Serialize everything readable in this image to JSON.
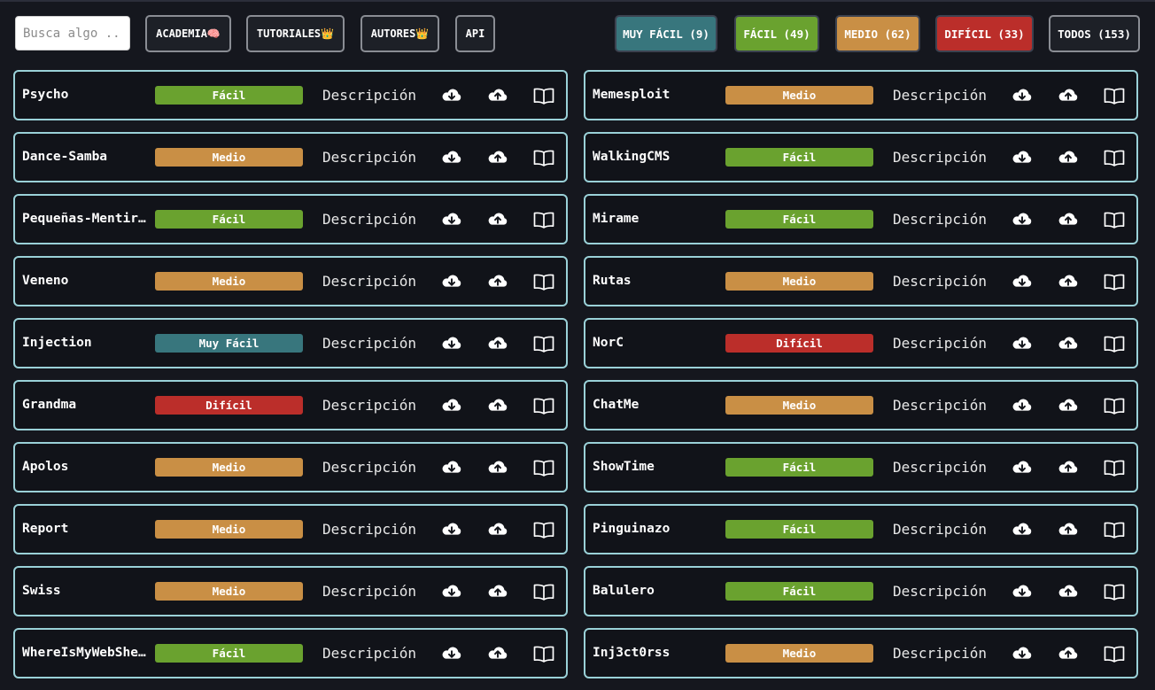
{
  "search": {
    "placeholder": "Busca algo ..."
  },
  "nav": {
    "academia": "ACADEMIA🧠",
    "tutoriales": "TUTORIALES👑",
    "autores": "AUTORES👑",
    "api": "API"
  },
  "filters": [
    {
      "label": "MUY FÁCIL (9)",
      "color": "#38767d"
    },
    {
      "label": "FÁCIL (49)",
      "color": "#6aa22f"
    },
    {
      "label": "MEDIO (62)",
      "color": "#c98f45"
    },
    {
      "label": "DIFÍCIL (33)",
      "color": "#bb2e2a"
    },
    {
      "label": "TODOS (153)",
      "color": "#1d2027"
    }
  ],
  "difficulty_colors": {
    "Muy Fácil": "#38767d",
    "Fácil": "#6aa22f",
    "Medio": "#c98f45",
    "Difícil": "#bb2e2a"
  },
  "description_label": "Descripción",
  "icons": {
    "download": "cloud-download-icon",
    "upload": "cloud-upload-icon",
    "writeup": "open-book-icon"
  },
  "machines_left": [
    {
      "name": "Psycho",
      "difficulty": "Fácil"
    },
    {
      "name": "Dance-Samba",
      "difficulty": "Medio"
    },
    {
      "name": "Pequeñas-Mentirosas",
      "difficulty": "Fácil"
    },
    {
      "name": "Veneno",
      "difficulty": "Medio"
    },
    {
      "name": "Injection",
      "difficulty": "Muy Fácil"
    },
    {
      "name": "Grandma",
      "difficulty": "Difícil"
    },
    {
      "name": "Apolos",
      "difficulty": "Medio"
    },
    {
      "name": "Report",
      "difficulty": "Medio"
    },
    {
      "name": "Swiss",
      "difficulty": "Medio"
    },
    {
      "name": "WhereIsMyWebShell",
      "difficulty": "Fácil"
    }
  ],
  "machines_right": [
    {
      "name": "Memesploit",
      "difficulty": "Medio"
    },
    {
      "name": "WalkingCMS",
      "difficulty": "Fácil"
    },
    {
      "name": "Mirame",
      "difficulty": "Fácil"
    },
    {
      "name": "Rutas",
      "difficulty": "Medio"
    },
    {
      "name": "NorC",
      "difficulty": "Difícil"
    },
    {
      "name": "ChatMe",
      "difficulty": "Medio"
    },
    {
      "name": "ShowTime",
      "difficulty": "Fácil"
    },
    {
      "name": "Pinguinazo",
      "difficulty": "Fácil"
    },
    {
      "name": "Balulero",
      "difficulty": "Fácil"
    },
    {
      "name": "Inj3ct0rss",
      "difficulty": "Medio"
    }
  ]
}
